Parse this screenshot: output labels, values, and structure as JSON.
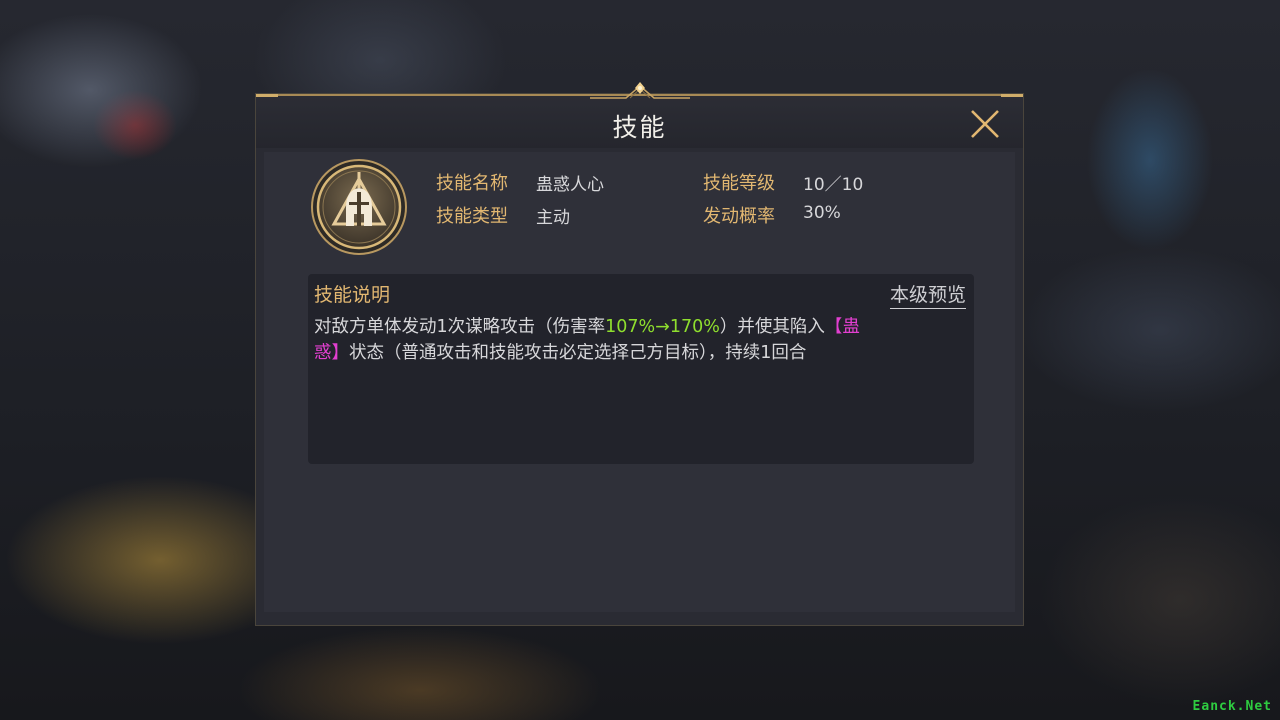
{
  "dialog": {
    "title": "技能",
    "close_icon": "close-icon"
  },
  "skill": {
    "icon": "spartan-helmet-emblem-icon",
    "name_label": "技能名称",
    "name_value": "蛊惑人心",
    "level_label": "技能等级",
    "level_value": "10／10",
    "type_label": "技能类型",
    "type_value": "主动",
    "chance_label": "发动概率",
    "chance_value": "30%"
  },
  "description": {
    "title": "技能说明",
    "preview_link": "本级预览",
    "text_part1": "对敌方单体发动1次谋略攻击（伤害率",
    "damage_rate": "107%→170%",
    "text_part2": "）并使其陷入",
    "status_name_1": "【蛊",
    "status_name_2": "惑】",
    "text_part3": "状态（普通攻击和技能攻击必定选择己方目标），持续1回合"
  },
  "colors": {
    "label_gold": "#e2b771",
    "highlight_green": "#8fdf2e",
    "highlight_pink": "#e23fd0"
  },
  "watermark": "Eanck.Net"
}
